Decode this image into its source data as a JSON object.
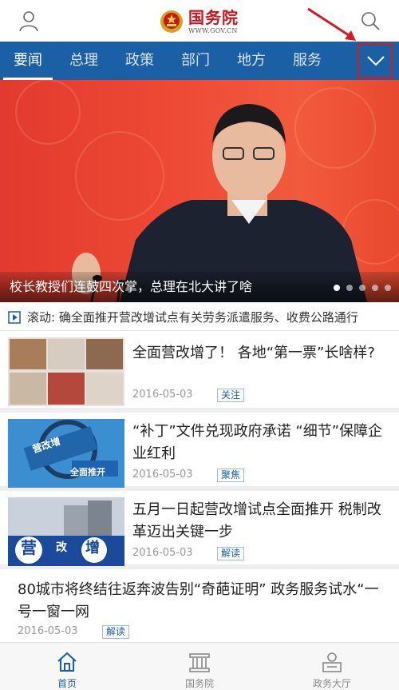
{
  "header": {
    "logo_cn": "国务院",
    "logo_en": "WWW.GOV.CN",
    "left_icon": "user-icon",
    "right_icon": "search-icon"
  },
  "nav": {
    "tabs": [
      {
        "label": "要闻",
        "active": true
      },
      {
        "label": "总理",
        "active": false
      },
      {
        "label": "政策",
        "active": false
      },
      {
        "label": "部门",
        "active": false
      },
      {
        "label": "地方",
        "active": false
      },
      {
        "label": "服务",
        "active": false
      }
    ],
    "expand_icon": "chevron-down-icon"
  },
  "hero": {
    "caption": "校长教授们连鼓四次掌，总理在北大讲了啥",
    "slide_count": 5,
    "active_slide": 1
  },
  "ticker": {
    "text": "滚动: 确全面推开营改增试点有关劳务派遣服务、收费公路通行"
  },
  "feed": [
    {
      "title": "全面营改增了！ 各地“第一票”长啥样?",
      "date": "2016-05-03",
      "tag": "关注"
    },
    {
      "title": "“补丁”文件兑现政府承诺 “细节”保障企业红利",
      "date": "2016-05-03",
      "tag": "聚焦"
    },
    {
      "title": "五月一日起营改增试点全面推开 税制改革迈出关键一步",
      "date": "2016-05-03",
      "tag": "解读",
      "thumb_text": [
        "营",
        "改",
        "增"
      ]
    },
    {
      "title": "80城市将终结往返奔波告别“奇葩证明” 政务服务试水“一号一窗一网",
      "date": "2016-05-03",
      "tag": "解读"
    }
  ],
  "thumb2_text": [
    "营改增",
    "全面推开"
  ],
  "bottom_nav": [
    {
      "label": "首页",
      "icon": "home-icon",
      "active": true
    },
    {
      "label": "国务院",
      "icon": "building-icon",
      "active": false
    },
    {
      "label": "政务大厅",
      "icon": "service-hall-icon",
      "active": false
    }
  ],
  "colors": {
    "nav_blue": "#1b5fa5",
    "brand_red": "#c8161e",
    "annotation_red": "#d71920"
  }
}
